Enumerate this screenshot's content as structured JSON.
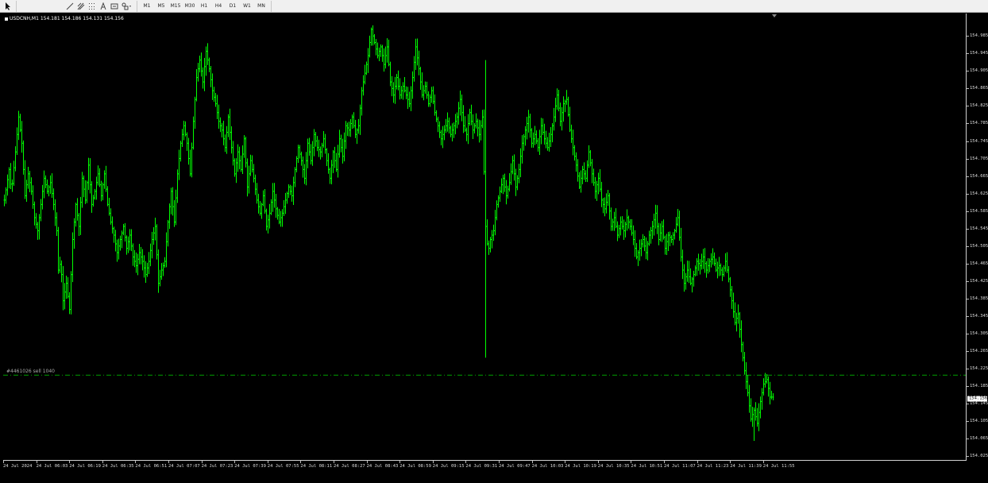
{
  "toolbar": {
    "timeframes": [
      "M1",
      "M5",
      "M15",
      "M30",
      "H1",
      "H4",
      "D1",
      "W1",
      "MN"
    ]
  },
  "chart": {
    "symbol_info": "USDCNH,M1  154.181 154.186 154.131 154.156",
    "hline_label": "#4461026 sell 1040",
    "hline_price": 154.21,
    "current_price": "154.156",
    "colors": {
      "background": "#000000",
      "candles": "#00ff00",
      "hline": "#00a000",
      "text": "#dddddd"
    }
  },
  "price_axis": {
    "labels": [
      "154.985",
      "154.945",
      "154.905",
      "154.865",
      "154.825",
      "154.785",
      "154.745",
      "154.705",
      "154.665",
      "154.625",
      "154.585",
      "154.545",
      "154.505",
      "154.465",
      "154.425",
      "154.385",
      "154.345",
      "154.305",
      "154.265",
      "154.225",
      "154.185",
      "154.145",
      "154.105",
      "154.065",
      "154.025"
    ]
  },
  "time_axis": {
    "labels": [
      "24 Jul 2024",
      "24 Jul 06:03",
      "24 Jul 06:19",
      "24 Jul 06:35",
      "24 Jul 06:51",
      "24 Jul 07:07",
      "24 Jul 07:23",
      "24 Jul 07:39",
      "24 Jul 07:55",
      "24 Jul 08:11",
      "24 Jul 08:27",
      "24 Jul 08:43",
      "24 Jul 08:59",
      "24 Jul 09:15",
      "24 Jul 09:31",
      "24 Jul 09:47",
      "24 Jul 10:03",
      "24 Jul 10:19",
      "24 Jul 10:35",
      "24 Jul 10:51",
      "24 Jul 11:07",
      "24 Jul 11:23",
      "24 Jul 11:39",
      "24 Jul 11:55"
    ]
  },
  "chart_data": {
    "type": "ohlc",
    "symbol": "USDCNH",
    "timeframe": "M1",
    "ylim": [
      154.02,
      155.0
    ],
    "bar_color": "#00ff00",
    "points": [
      [
        0,
        154.61
      ],
      [
        6,
        154.68
      ],
      [
        9,
        154.63
      ],
      [
        14,
        154.72
      ],
      [
        18,
        154.8
      ],
      [
        22,
        154.74
      ],
      [
        26,
        154.62
      ],
      [
        30,
        154.67
      ],
      [
        34,
        154.63
      ],
      [
        38,
        154.57
      ],
      [
        42,
        154.54
      ],
      [
        46,
        154.6
      ],
      [
        50,
        154.66
      ],
      [
        54,
        154.63
      ],
      [
        58,
        154.65
      ],
      [
        62,
        154.6
      ],
      [
        66,
        154.54
      ],
      [
        68,
        154.45
      ],
      [
        71,
        154.47
      ],
      [
        74,
        154.38
      ],
      [
        78,
        154.42
      ],
      [
        82,
        154.36
      ],
      [
        86,
        154.52
      ],
      [
        90,
        154.6
      ],
      [
        94,
        154.55
      ],
      [
        98,
        154.66
      ],
      [
        102,
        154.61
      ],
      [
        106,
        154.69
      ],
      [
        110,
        154.6
      ],
      [
        114,
        154.63
      ],
      [
        118,
        154.67
      ],
      [
        122,
        154.62
      ],
      [
        126,
        154.67
      ],
      [
        130,
        154.6
      ],
      [
        134,
        154.56
      ],
      [
        138,
        154.53
      ],
      [
        142,
        154.49
      ],
      [
        146,
        154.52
      ],
      [
        150,
        154.55
      ],
      [
        154,
        154.5
      ],
      [
        158,
        154.53
      ],
      [
        162,
        154.48
      ],
      [
        166,
        154.46
      ],
      [
        170,
        154.49
      ],
      [
        174,
        154.47
      ],
      [
        178,
        154.44
      ],
      [
        182,
        154.47
      ],
      [
        186,
        154.52
      ],
      [
        190,
        154.55
      ],
      [
        194,
        154.42
      ],
      [
        198,
        154.45
      ],
      [
        202,
        154.47
      ],
      [
        206,
        154.56
      ],
      [
        210,
        154.63
      ],
      [
        214,
        154.56
      ],
      [
        218,
        154.67
      ],
      [
        222,
        154.74
      ],
      [
        226,
        154.78
      ],
      [
        230,
        154.74
      ],
      [
        234,
        154.67
      ],
      [
        238,
        154.79
      ],
      [
        242,
        154.89
      ],
      [
        246,
        154.93
      ],
      [
        250,
        154.88
      ],
      [
        254,
        154.95
      ],
      [
        258,
        154.91
      ],
      [
        262,
        154.86
      ],
      [
        266,
        154.83
      ],
      [
        270,
        154.79
      ],
      [
        274,
        154.77
      ],
      [
        278,
        154.73
      ],
      [
        282,
        154.8
      ],
      [
        286,
        154.73
      ],
      [
        290,
        154.67
      ],
      [
        294,
        154.72
      ],
      [
        298,
        154.68
      ],
      [
        302,
        154.75
      ],
      [
        306,
        154.64
      ],
      [
        310,
        154.7
      ],
      [
        314,
        154.66
      ],
      [
        318,
        154.61
      ],
      [
        322,
        154.58
      ],
      [
        326,
        154.62
      ],
      [
        330,
        154.55
      ],
      [
        334,
        154.58
      ],
      [
        338,
        154.63
      ],
      [
        342,
        154.59
      ],
      [
        346,
        154.56
      ],
      [
        350,
        154.58
      ],
      [
        354,
        154.61
      ],
      [
        358,
        154.64
      ],
      [
        362,
        154.62
      ],
      [
        366,
        154.68
      ],
      [
        370,
        154.73
      ],
      [
        374,
        154.7
      ],
      [
        378,
        154.66
      ],
      [
        382,
        154.74
      ],
      [
        386,
        154.7
      ],
      [
        390,
        154.76
      ],
      [
        394,
        154.73
      ],
      [
        398,
        154.72
      ],
      [
        402,
        154.75
      ],
      [
        406,
        154.7
      ],
      [
        410,
        154.66
      ],
      [
        414,
        154.72
      ],
      [
        418,
        154.68
      ],
      [
        422,
        154.75
      ],
      [
        426,
        154.71
      ],
      [
        430,
        154.78
      ],
      [
        434,
        154.77
      ],
      [
        438,
        154.8
      ],
      [
        442,
        154.76
      ],
      [
        446,
        154.78
      ],
      [
        450,
        154.86
      ],
      [
        454,
        154.9
      ],
      [
        458,
        154.94
      ],
      [
        462,
        155.0
      ],
      [
        466,
        154.97
      ],
      [
        470,
        154.94
      ],
      [
        474,
        154.96
      ],
      [
        478,
        154.92
      ],
      [
        482,
        154.96
      ],
      [
        486,
        154.88
      ],
      [
        490,
        154.85
      ],
      [
        494,
        154.89
      ],
      [
        498,
        154.85
      ],
      [
        502,
        154.87
      ],
      [
        506,
        154.85
      ],
      [
        510,
        154.83
      ],
      [
        514,
        154.89
      ],
      [
        518,
        154.96
      ],
      [
        522,
        154.91
      ],
      [
        526,
        154.85
      ],
      [
        530,
        154.87
      ],
      [
        534,
        154.83
      ],
      [
        538,
        154.86
      ],
      [
        542,
        154.81
      ],
      [
        546,
        154.78
      ],
      [
        550,
        154.75
      ],
      [
        554,
        154.77
      ],
      [
        558,
        154.79
      ],
      [
        562,
        154.76
      ],
      [
        566,
        154.78
      ],
      [
        570,
        154.8
      ],
      [
        574,
        154.84
      ],
      [
        578,
        154.78
      ],
      [
        582,
        154.76
      ],
      [
        586,
        154.81
      ],
      [
        590,
        154.77
      ],
      [
        594,
        154.79
      ],
      [
        598,
        154.76
      ],
      [
        602,
        154.8
      ],
      [
        606,
        154.55
      ],
      [
        609,
        154.49
      ],
      [
        612,
        154.52
      ],
      [
        616,
        154.54
      ],
      [
        620,
        154.6
      ],
      [
        624,
        154.63
      ],
      [
        628,
        154.66
      ],
      [
        632,
        154.62
      ],
      [
        636,
        154.65
      ],
      [
        640,
        154.7
      ],
      [
        644,
        154.64
      ],
      [
        648,
        154.68
      ],
      [
        652,
        154.74
      ],
      [
        656,
        154.77
      ],
      [
        660,
        154.8
      ],
      [
        664,
        154.74
      ],
      [
        668,
        154.76
      ],
      [
        672,
        154.73
      ],
      [
        676,
        154.78
      ],
      [
        680,
        154.75
      ],
      [
        684,
        154.73
      ],
      [
        688,
        154.76
      ],
      [
        692,
        154.8
      ],
      [
        696,
        154.85
      ],
      [
        700,
        154.79
      ],
      [
        704,
        154.83
      ],
      [
        708,
        154.84
      ],
      [
        712,
        154.77
      ],
      [
        716,
        154.73
      ],
      [
        720,
        154.69
      ],
      [
        724,
        154.64
      ],
      [
        728,
        154.68
      ],
      [
        732,
        154.66
      ],
      [
        736,
        154.72
      ],
      [
        740,
        154.67
      ],
      [
        744,
        154.63
      ],
      [
        748,
        154.66
      ],
      [
        752,
        154.61
      ],
      [
        756,
        154.59
      ],
      [
        760,
        154.62
      ],
      [
        764,
        154.55
      ],
      [
        768,
        154.57
      ],
      [
        772,
        154.53
      ],
      [
        776,
        154.56
      ],
      [
        780,
        154.54
      ],
      [
        784,
        154.57
      ],
      [
        788,
        154.55
      ],
      [
        792,
        154.52
      ],
      [
        796,
        154.48
      ],
      [
        800,
        154.5
      ],
      [
        804,
        154.52
      ],
      [
        808,
        154.49
      ],
      [
        812,
        154.53
      ],
      [
        816,
        154.55
      ],
      [
        820,
        154.58
      ],
      [
        824,
        154.52
      ],
      [
        828,
        154.55
      ],
      [
        832,
        154.5
      ],
      [
        836,
        154.53
      ],
      [
        840,
        154.52
      ],
      [
        844,
        154.54
      ],
      [
        848,
        154.57
      ],
      [
        852,
        154.48
      ],
      [
        856,
        154.42
      ],
      [
        860,
        154.45
      ],
      [
        864,
        154.42
      ],
      [
        868,
        154.44
      ],
      [
        872,
        154.47
      ],
      [
        876,
        154.46
      ],
      [
        880,
        154.48
      ],
      [
        884,
        154.45
      ],
      [
        888,
        154.47
      ],
      [
        892,
        154.48
      ],
      [
        896,
        154.45
      ],
      [
        900,
        154.46
      ],
      [
        904,
        154.44
      ],
      [
        908,
        154.47
      ],
      [
        912,
        154.43
      ],
      [
        916,
        154.38
      ],
      [
        920,
        154.33
      ],
      [
        924,
        154.35
      ],
      [
        928,
        154.28
      ],
      [
        932,
        154.22
      ],
      [
        936,
        154.17
      ],
      [
        940,
        154.11
      ],
      [
        944,
        154.13
      ],
      [
        948,
        154.1
      ],
      [
        952,
        154.15
      ],
      [
        956,
        154.19
      ],
      [
        960,
        154.2
      ],
      [
        964,
        154.16
      ],
      [
        968,
        154.16
      ]
    ]
  }
}
